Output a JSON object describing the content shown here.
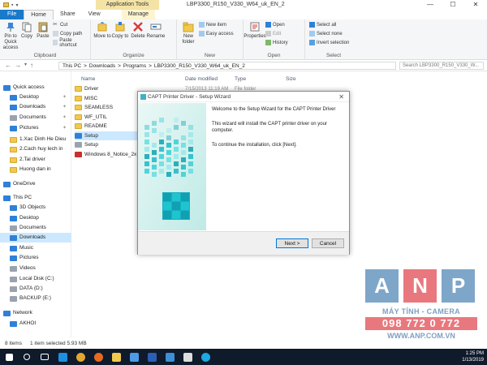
{
  "window": {
    "title": "LBP3300_R150_V330_W64_uk_EN_2",
    "context_tab": "Application Tools",
    "controls": [
      "—",
      "☐",
      "✕"
    ]
  },
  "tabs": [
    "File",
    "Home",
    "Share",
    "View",
    "Manage"
  ],
  "ribbon": {
    "clipboard": {
      "pin": "Pin to Quick access",
      "copy": "Copy",
      "paste": "Paste",
      "cut": "Cut",
      "copy_path": "Copy path",
      "paste_shortcut": "Paste shortcut",
      "label": "Clipboard"
    },
    "organize": {
      "move_to": "Move to",
      "copy_to": "Copy to",
      "delete": "Delete",
      "rename": "Rename",
      "label": "Organize"
    },
    "new": {
      "new_folder": "New folder",
      "new_item": "New item",
      "easy_access": "Easy access",
      "label": "New"
    },
    "open": {
      "properties": "Properties",
      "open": "Open",
      "edit": "Edit",
      "history": "History",
      "label": "Open"
    },
    "select": {
      "select_all": "Select all",
      "select_none": "Select none",
      "invert": "Invert selection",
      "label": "Select"
    }
  },
  "address": {
    "crumbs": [
      "This PC",
      ">",
      "Downloads",
      ">",
      "Programs",
      ">",
      "LBP3300_R150_V330_W64_uk_EN_2"
    ],
    "search_placeholder": "Search LBP3300_R150_V330_W..."
  },
  "nav": [
    {
      "label": "Quick access",
      "icon": "star-icon",
      "pinned": false
    },
    {
      "label": "Desktop",
      "icon": "desktop-icon",
      "pinned": true
    },
    {
      "label": "Downloads",
      "icon": "download-icon",
      "pinned": true
    },
    {
      "label": "Documents",
      "icon": "document-icon",
      "pinned": true
    },
    {
      "label": "Pictures",
      "icon": "picture-icon",
      "pinned": true
    },
    {
      "label": "1.Xac Dinh He Dieu",
      "icon": "folder-icon",
      "pinned": false
    },
    {
      "label": "2.Cach huy lech in",
      "icon": "folder-icon",
      "pinned": false
    },
    {
      "label": "2.Tai driver",
      "icon": "folder-icon",
      "pinned": false
    },
    {
      "label": "Huong dan in",
      "icon": "folder-icon",
      "pinned": false
    },
    {
      "label": "OneDrive",
      "icon": "cloud-icon",
      "pinned": false
    },
    {
      "label": "This PC",
      "icon": "computer-icon",
      "pinned": false
    },
    {
      "label": "3D Objects",
      "icon": "cube-icon",
      "pinned": false
    },
    {
      "label": "Desktop",
      "icon": "desktop-icon",
      "pinned": false
    },
    {
      "label": "Documents",
      "icon": "document-icon",
      "pinned": false
    },
    {
      "label": "Downloads",
      "icon": "download-icon",
      "pinned": false
    },
    {
      "label": "Music",
      "icon": "music-icon",
      "pinned": false
    },
    {
      "label": "Pictures",
      "icon": "picture-icon",
      "pinned": false
    },
    {
      "label": "Videos",
      "icon": "video-icon",
      "pinned": false
    },
    {
      "label": "Local Disk (C:)",
      "icon": "disk-icon",
      "pinned": false
    },
    {
      "label": "DATA (D:)",
      "icon": "disk-icon",
      "pinned": false
    },
    {
      "label": "BACKUP (E:)",
      "icon": "disk-icon",
      "pinned": false
    },
    {
      "label": "Network",
      "icon": "network-icon",
      "pinned": false
    },
    {
      "label": "AKHOI",
      "icon": "computer-icon",
      "pinned": false
    }
  ],
  "columns": [
    "Name",
    "Date modified",
    "Type",
    "Size"
  ],
  "files": [
    {
      "name": "Driver",
      "icon": "folder-icon"
    },
    {
      "name": "MISC",
      "icon": "folder-icon"
    },
    {
      "name": "SEAMLESS",
      "icon": "folder-icon"
    },
    {
      "name": "WF_UTIL",
      "icon": "folder-icon"
    },
    {
      "name": "README",
      "icon": "folder-icon"
    },
    {
      "name": "Setup",
      "icon": "setup-exe-icon"
    },
    {
      "name": "Setup",
      "icon": "ini-file-icon"
    },
    {
      "name": "Windows 8_Notice_2x",
      "icon": "pdf-icon"
    }
  ],
  "first_row_partial": {
    "date": "7/15/2013 11:19 AM",
    "type": "File folder"
  },
  "status": {
    "items": "8 items",
    "selected": "1 item selected  5.93 MB"
  },
  "dialog": {
    "title": "CAPT Printer Driver - Setup Wizard",
    "welcome": "Welcome to the Setup Wizard for the CAPT Printer Driver",
    "body": "This wizard will install the CAPT printer driver on your computer.",
    "cont": "To continue the installation, click [Next].",
    "next": "Next >",
    "cancel": "Cancel"
  },
  "watermark": {
    "letters": [
      "A",
      "N",
      "P"
    ],
    "tagline": "MÁY TÍNH - CAMERA",
    "phone": "098 772 0 772",
    "url": "WWW.ANP.COM.VN"
  },
  "taskbar": {
    "time": "1:25 PM",
    "date": "1/13/2019",
    "apps": [
      "start-icon",
      "search-icon",
      "task-view-icon",
      "edge-icon",
      "chrome-icon",
      "firefox-icon",
      "file-explorer-icon",
      "mail-icon",
      "word-icon",
      "photos-icon",
      "setup-app-icon",
      "skype-icon"
    ]
  },
  "colors": {
    "accent": "#1979ca",
    "selection": "#cce8ff",
    "taskbar": "#0f1a2b",
    "logo_blue": "#7ea6c9",
    "logo_red": "#e8787d"
  }
}
